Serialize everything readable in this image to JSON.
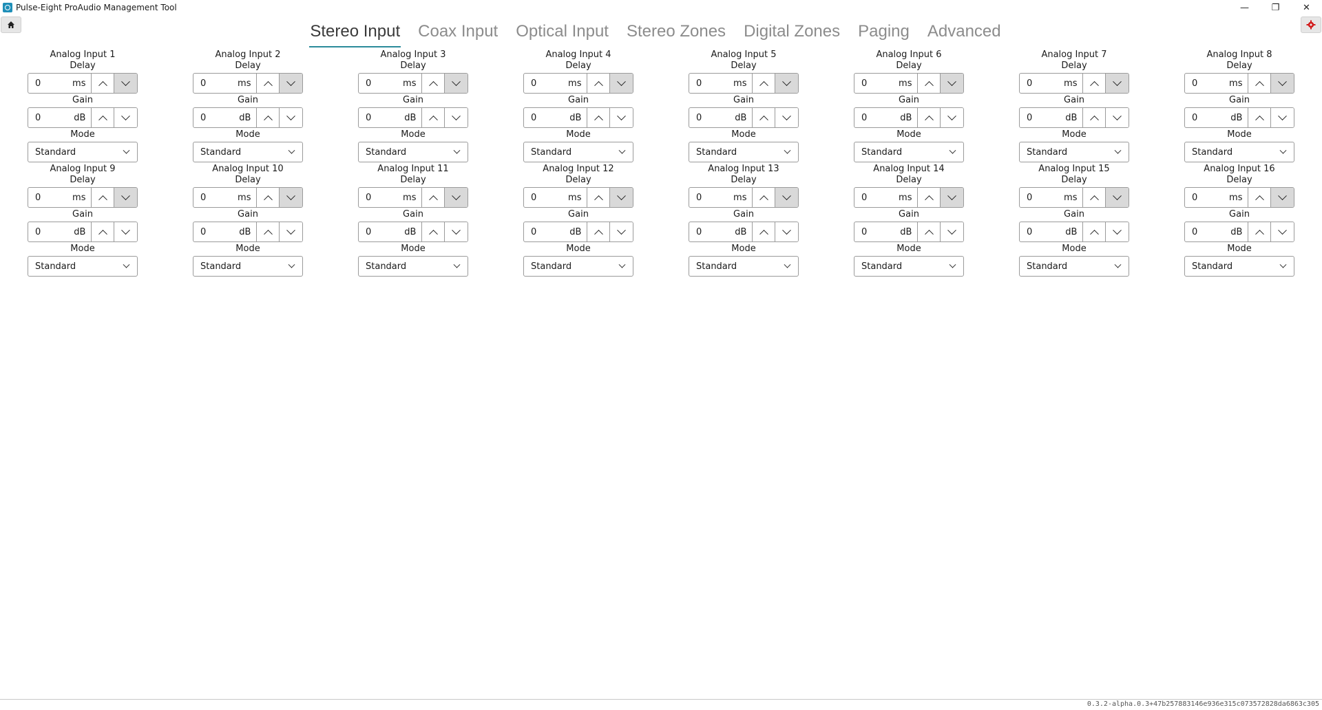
{
  "window": {
    "title": "Pulse-Eight ProAudio Management Tool",
    "controls": {
      "minimize": "—",
      "restore": "❐",
      "close": "✕"
    }
  },
  "toolbar": {
    "home_icon": "home-icon",
    "settings_icon": "gear-icon"
  },
  "tabs": [
    {
      "label": "Stereo Input",
      "active": true
    },
    {
      "label": "Coax Input",
      "active": false
    },
    {
      "label": "Optical Input",
      "active": false
    },
    {
      "label": "Stereo Zones",
      "active": false
    },
    {
      "label": "Digital Zones",
      "active": false
    },
    {
      "label": "Paging",
      "active": false
    },
    {
      "label": "Advanced",
      "active": false
    }
  ],
  "labels": {
    "delay": "Delay",
    "gain": "Gain",
    "mode": "Mode",
    "delay_unit": "ms",
    "gain_unit": "dB"
  },
  "channels": [
    {
      "name": "Analog Input 1",
      "delay": "0",
      "gain": "0",
      "mode": "Standard"
    },
    {
      "name": "Analog Input 2",
      "delay": "0",
      "gain": "0",
      "mode": "Standard"
    },
    {
      "name": "Analog Input 3",
      "delay": "0",
      "gain": "0",
      "mode": "Standard"
    },
    {
      "name": "Analog Input 4",
      "delay": "0",
      "gain": "0",
      "mode": "Standard"
    },
    {
      "name": "Analog Input 5",
      "delay": "0",
      "gain": "0",
      "mode": "Standard"
    },
    {
      "name": "Analog Input 6",
      "delay": "0",
      "gain": "0",
      "mode": "Standard"
    },
    {
      "name": "Analog Input 7",
      "delay": "0",
      "gain": "0",
      "mode": "Standard"
    },
    {
      "name": "Analog Input 8",
      "delay": "0",
      "gain": "0",
      "mode": "Standard"
    },
    {
      "name": "Analog Input 9",
      "delay": "0",
      "gain": "0",
      "mode": "Standard"
    },
    {
      "name": "Analog Input 10",
      "delay": "0",
      "gain": "0",
      "mode": "Standard"
    },
    {
      "name": "Analog Input 11",
      "delay": "0",
      "gain": "0",
      "mode": "Standard"
    },
    {
      "name": "Analog Input 12",
      "delay": "0",
      "gain": "0",
      "mode": "Standard"
    },
    {
      "name": "Analog Input 13",
      "delay": "0",
      "gain": "0",
      "mode": "Standard"
    },
    {
      "name": "Analog Input 14",
      "delay": "0",
      "gain": "0",
      "mode": "Standard"
    },
    {
      "name": "Analog Input 15",
      "delay": "0",
      "gain": "0",
      "mode": "Standard"
    },
    {
      "name": "Analog Input 16",
      "delay": "0",
      "gain": "0",
      "mode": "Standard"
    }
  ],
  "status": {
    "version": "0.3.2-alpha.0.3+47b257883146e936e315c073572828da6863c305"
  },
  "colors": {
    "accent": "#2a8a9a",
    "settings": "#d21a1a"
  }
}
